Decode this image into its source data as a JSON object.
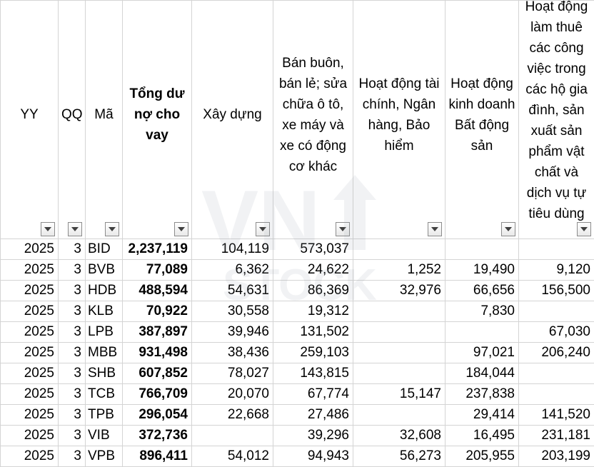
{
  "headers": {
    "yy": "YY",
    "qq": "QQ",
    "ma": "Mã",
    "tong": "Tổng dư nợ cho vay",
    "xaydung": "Xây dựng",
    "banbuon": "Bán buôn, bán lẻ; sửa chữa ô tô, xe máy và xe có động cơ khác",
    "taichinh": "Hoạt động tài chính, Ngân hàng, Bảo hiểm",
    "batdongsan": "Hoạt động kinh doanh Bất động sản",
    "lamthue": "Hoạt động làm thuê các công việc trong các hộ gia đình, sản xuất sản phẩm vật chất và dịch vụ tự tiêu dùng"
  },
  "watermark": {
    "line1": "VN",
    "line2": "STOCK"
  },
  "rows": [
    {
      "yy": "2025",
      "qq": "3",
      "ma": "BID",
      "tong": "2,237,119",
      "xaydung": "104,119",
      "banbuon": "573,037",
      "taichinh": "",
      "batdongsan": "",
      "lamthue": ""
    },
    {
      "yy": "2025",
      "qq": "3",
      "ma": "BVB",
      "tong": "77,089",
      "xaydung": "6,362",
      "banbuon": "24,622",
      "taichinh": "1,252",
      "batdongsan": "19,490",
      "lamthue": "9,120"
    },
    {
      "yy": "2025",
      "qq": "3",
      "ma": "HDB",
      "tong": "488,594",
      "xaydung": "54,631",
      "banbuon": "86,369",
      "taichinh": "32,976",
      "batdongsan": "66,656",
      "lamthue": "156,500"
    },
    {
      "yy": "2025",
      "qq": "3",
      "ma": "KLB",
      "tong": "70,922",
      "xaydung": "30,558",
      "banbuon": "19,312",
      "taichinh": "",
      "batdongsan": "7,830",
      "lamthue": ""
    },
    {
      "yy": "2025",
      "qq": "3",
      "ma": "LPB",
      "tong": "387,897",
      "xaydung": "39,946",
      "banbuon": "131,502",
      "taichinh": "",
      "batdongsan": "",
      "lamthue": "67,030"
    },
    {
      "yy": "2025",
      "qq": "3",
      "ma": "MBB",
      "tong": "931,498",
      "xaydung": "38,436",
      "banbuon": "259,103",
      "taichinh": "",
      "batdongsan": "97,021",
      "lamthue": "206,240"
    },
    {
      "yy": "2025",
      "qq": "3",
      "ma": "SHB",
      "tong": "607,852",
      "xaydung": "78,027",
      "banbuon": "143,815",
      "taichinh": "",
      "batdongsan": "184,044",
      "lamthue": ""
    },
    {
      "yy": "2025",
      "qq": "3",
      "ma": "TCB",
      "tong": "766,709",
      "xaydung": "20,070",
      "banbuon": "67,774",
      "taichinh": "15,147",
      "batdongsan": "237,838",
      "lamthue": ""
    },
    {
      "yy": "2025",
      "qq": "3",
      "ma": "TPB",
      "tong": "296,054",
      "xaydung": "22,668",
      "banbuon": "27,486",
      "taichinh": "",
      "batdongsan": "29,414",
      "lamthue": "141,520"
    },
    {
      "yy": "2025",
      "qq": "3",
      "ma": "VIB",
      "tong": "372,736",
      "xaydung": "",
      "banbuon": "39,296",
      "taichinh": "32,608",
      "batdongsan": "16,495",
      "lamthue": "231,181"
    },
    {
      "yy": "2025",
      "qq": "3",
      "ma": "VPB",
      "tong": "896,411",
      "xaydung": "54,012",
      "banbuon": "94,943",
      "taichinh": "56,273",
      "batdongsan": "205,955",
      "lamthue": "203,199"
    }
  ]
}
